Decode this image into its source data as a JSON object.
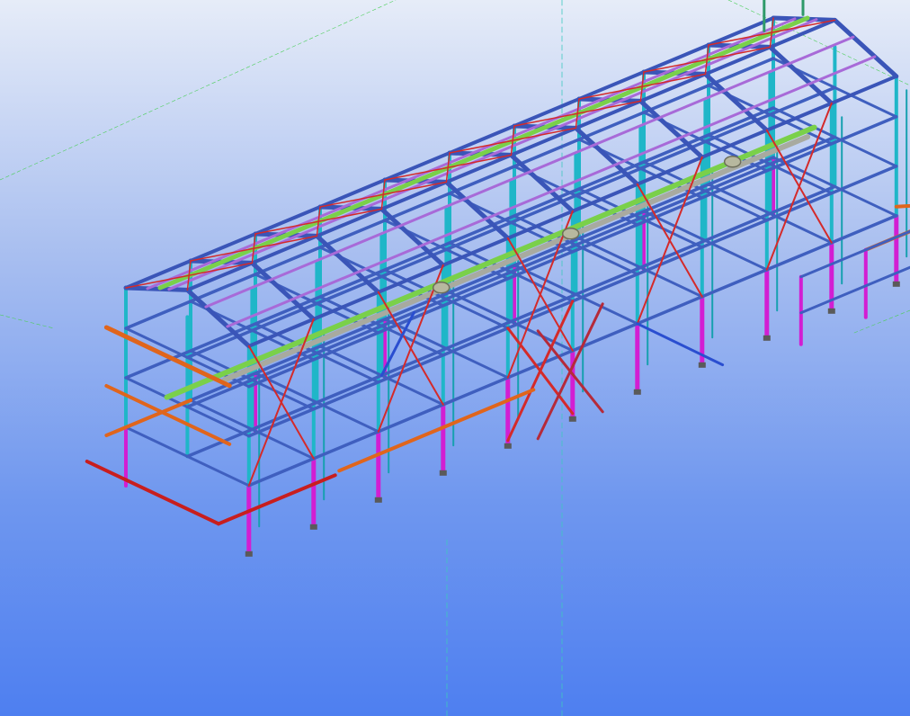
{
  "viewport": {
    "background_top": "#e6ecf8",
    "background_bottom": "#4e7ff0"
  },
  "model": {
    "bays": 10,
    "member_colors": {
      "column": "#1fb6c8",
      "beam": "#3f5fbf",
      "roof_rafter": "#3a55b8",
      "purlin": "#a86ad8",
      "bracing": "#d42a2a",
      "grating": "#7ad04a",
      "platform_beam": "#e0651c",
      "pier": "#d21ed2",
      "pipe": "#a8aaa0",
      "stair": "#2f9a6a"
    }
  }
}
